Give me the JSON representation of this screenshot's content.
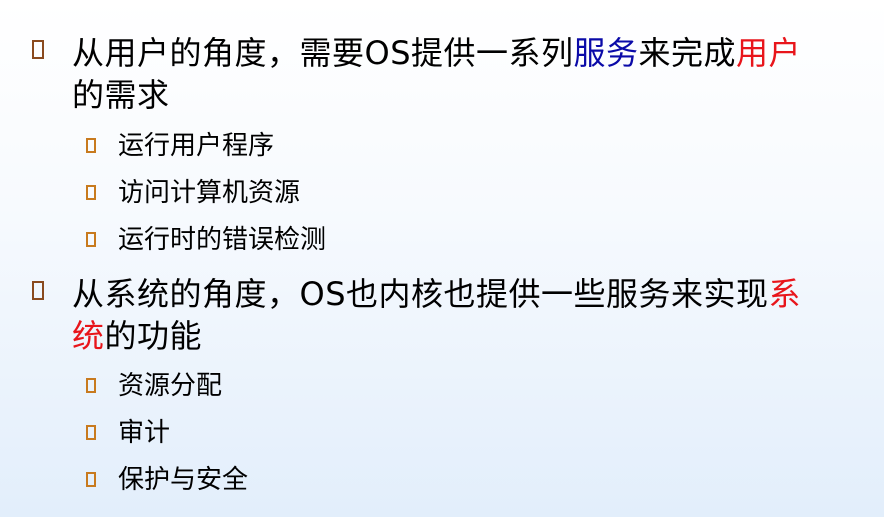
{
  "point1": {
    "seg1": "从用户的角度，需要OS提供一系列",
    "seg2": "服务",
    "seg3": "来完成",
    "seg4": "用户",
    "seg5": "的需求",
    "subitems": [
      "运行用户程序",
      "访问计算机资源",
      "运行时的错误检测"
    ]
  },
  "point2": {
    "seg1": "从系统的角度，OS也内核也提供一些服务来实现",
    "seg2": "系统",
    "seg3": "的功能",
    "subitems": [
      "资源分配",
      "审计",
      "保护与安全"
    ]
  },
  "colors": {
    "highlight_blue": "#0a0aa8",
    "highlight_red": "#e8151b",
    "bullet_main": "#8a4a1e",
    "bullet_sub": "#c87a1e"
  }
}
